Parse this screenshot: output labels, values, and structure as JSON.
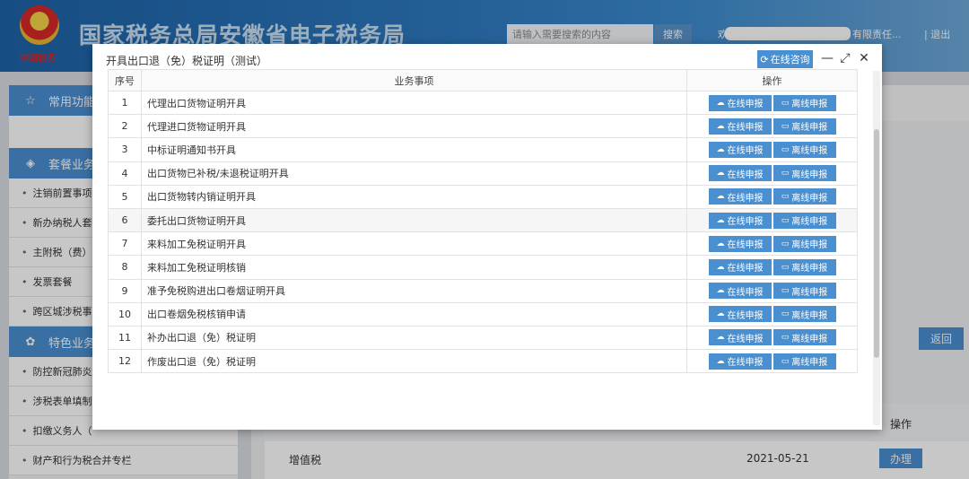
{
  "header": {
    "emblem_text": "中国税务",
    "title": "国家税务总局安徽省电子税务局",
    "search_placeholder": "请输入需要搜索的内容",
    "search_button": "搜索",
    "user_prefix": "欢迎",
    "user_suffix": "有限责任...",
    "logout": "| 退出"
  },
  "sidebar": {
    "common": "常用功能",
    "package": "套餐业务",
    "package_items": [
      "注销前置事项",
      "新办纳税人套",
      "主附税（费）",
      "发票套餐",
      "跨区城涉税事"
    ],
    "special": "特色业务",
    "special_items": [
      "防控新冠肺炎",
      "涉税表单填制",
      "扣缴义务人（",
      "财产和行为税合并专栏"
    ]
  },
  "background": {
    "return_button": "返回",
    "op_header": "操作",
    "tax_name": "增值税",
    "date": "2021-05-21",
    "handle_button": "办理"
  },
  "modal": {
    "title": "开具出口退（免）税证明（测试）",
    "consult_button": "在线咨询",
    "minimize": "—",
    "maximize": "⤢",
    "close": "✕",
    "columns": {
      "no": "序号",
      "item": "业务事项",
      "op": "操作"
    },
    "online_label": "在线申报",
    "offline_label": "离线申报",
    "rows": [
      {
        "no": "1",
        "name": "代理出口货物证明开具"
      },
      {
        "no": "2",
        "name": "代理进口货物证明开具"
      },
      {
        "no": "3",
        "name": "中标证明通知书开具"
      },
      {
        "no": "4",
        "name": "出口货物已补税/未退税证明开具"
      },
      {
        "no": "5",
        "name": "出口货物转内销证明开具"
      },
      {
        "no": "6",
        "name": "委托出口货物证明开具"
      },
      {
        "no": "7",
        "name": "来料加工免税证明开具"
      },
      {
        "no": "8",
        "name": "来料加工免税证明核销"
      },
      {
        "no": "9",
        "name": "准予免税购进出口卷烟证明开具"
      },
      {
        "no": "10",
        "name": "出口卷烟免税核销申请"
      },
      {
        "no": "11",
        "name": "补办出口退（免）税证明"
      },
      {
        "no": "12",
        "name": "作废出口退（免）税证明"
      }
    ]
  }
}
